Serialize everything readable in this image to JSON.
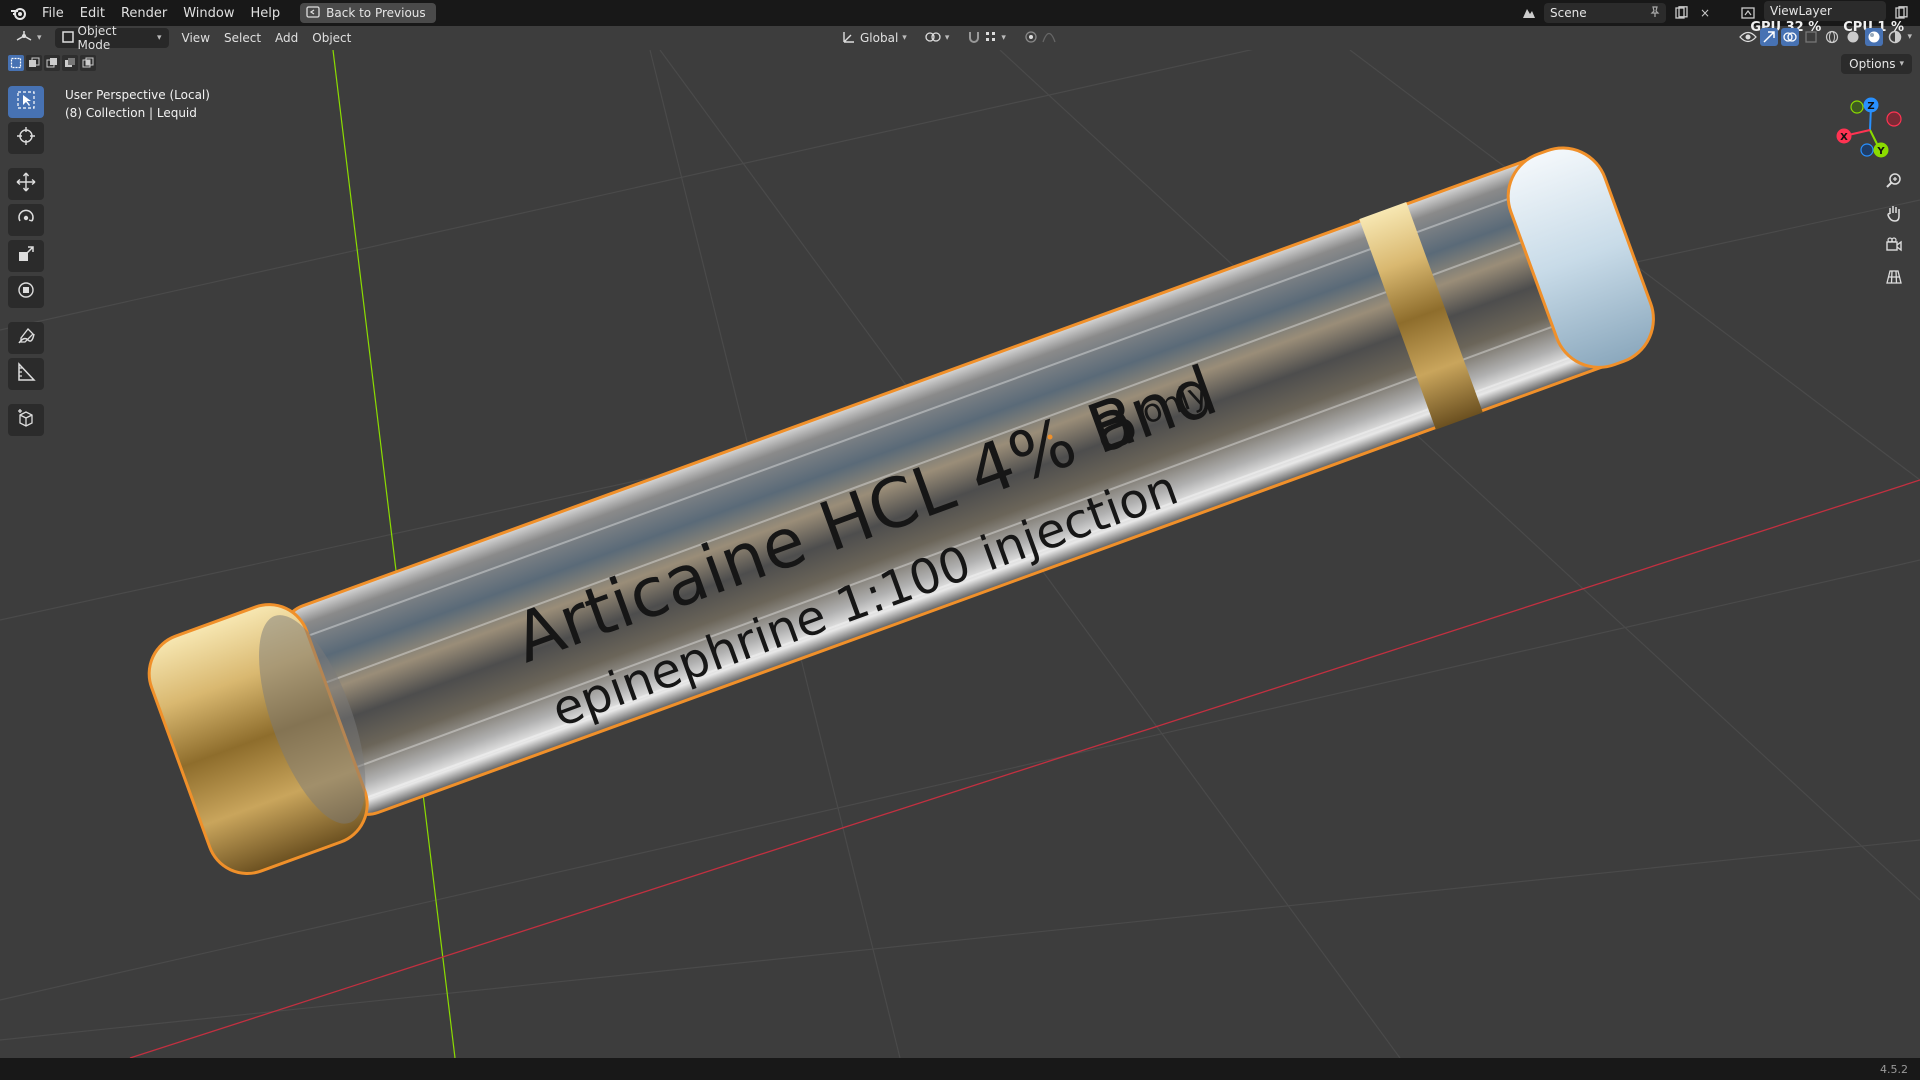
{
  "menu": {
    "file": "File",
    "edit": "Edit",
    "render": "Render",
    "window": "Window",
    "help": "Help",
    "back_to_previous": "Back to Previous"
  },
  "topbar": {
    "scene": "Scene",
    "view_layer": "ViewLayer",
    "gpu": "GPU 32 %",
    "cpu": "CPU 1 %"
  },
  "viewport_header": {
    "mode": "Object Mode",
    "view": "View",
    "select": "Select",
    "add": "Add",
    "object": "Object",
    "orientation": "Global",
    "options": "Options"
  },
  "viewport": {
    "perspective": "User Perspective (Local)",
    "collection": "(8) Collection | Lequid",
    "label_main": "Articaine HCL 4% and",
    "label_sub": "epinephrine 1:100 injection",
    "label_rx": "B",
    "label_only": "only"
  },
  "gizmo": {
    "x": "X",
    "y": "Y",
    "z": "Z"
  },
  "status": {
    "version": "4.5.2"
  },
  "colors": {
    "accent": "#4772b3",
    "selection_outline": "#f0902a",
    "x_axis": "#ff3352",
    "y_axis": "#8bdc00",
    "z_axis": "#2890ff"
  }
}
